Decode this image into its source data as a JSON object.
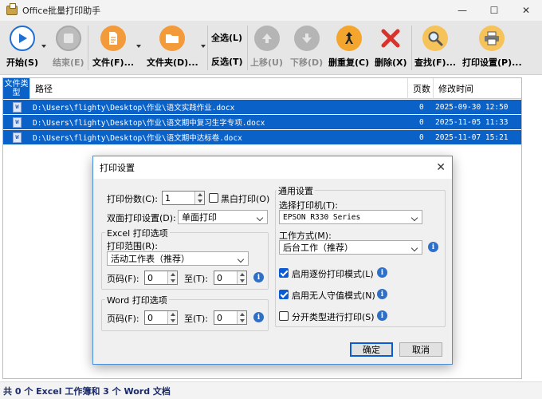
{
  "window": {
    "title": "Office批量打印助手",
    "minimize": "—",
    "maximize": "☐",
    "close": "✕"
  },
  "toolbar": {
    "start": "开始(S)",
    "stop": "结束(E)",
    "file": "文件(F)...",
    "folder": "文件夹(D)...",
    "select_all": "全选(L)",
    "invert": "反选(T)",
    "move_up": "上移(U)",
    "move_down": "下移(D)",
    "remove_dup": "删重复(C)",
    "delete": "删除(X)",
    "find": "查找(F)...",
    "print_settings": "打印设置(P)..."
  },
  "table": {
    "headers": {
      "type": "文件类型",
      "path": "路径",
      "pages": "页数",
      "modified": "修改时间"
    },
    "rows": [
      {
        "icon": "W",
        "path": "D:\\Users\\flighty\\Desktop\\作业\\语文实践作业.docx",
        "pages": "0",
        "modified": "2025-09-30 12:50"
      },
      {
        "icon": "W",
        "path": "D:\\Users\\flighty\\Desktop\\作业\\语文期中复习生字专项.docx",
        "pages": "0",
        "modified": "2025-11-05 11:33"
      },
      {
        "icon": "W",
        "path": "D:\\Users\\flighty\\Desktop\\作业\\语文期中达标卷.docx",
        "pages": "0",
        "modified": "2025-11-07 15:21"
      }
    ]
  },
  "status": "共 0 个 Excel 工作簿和 3 个 Word 文档",
  "dialog": {
    "title": "打印设置",
    "close": "✕",
    "copies_label": "打印份数(C):",
    "copies_value": "1",
    "bw_label": "黑白打印(O)",
    "duplex_label": "双面打印设置(D):",
    "duplex_value": "单面打印",
    "excel_group": "Excel 打印选项",
    "range_label": "打印范围(R):",
    "range_value": "活动工作表（推荐）",
    "page_from_label": "页码(F):",
    "page_from_value": "0",
    "page_to_label": "至(T):",
    "page_to_value": "0",
    "word_group": "Word 打印选项",
    "word_from_label": "页码(F):",
    "word_from_value": "0",
    "word_to_label": "至(T):",
    "word_to_value": "0",
    "general_group": "通用设置",
    "printer_label": "选择打印机(T):",
    "printer_value": "EPSON R330 Series",
    "mode_label": "工作方式(M):",
    "mode_value": "后台工作（推荐）",
    "collate_label": "启用逐份打印模式(L)",
    "unattended_label": "启用无人守值模式(N)",
    "separate_label": "分开类型进行打印(S)",
    "ok": "确定",
    "cancel": "取消",
    "info": "i"
  },
  "colors": {
    "selection": "#0a62c9",
    "start_icon": "#1f6fd1",
    "delete_icon": "#d9342b",
    "brand_blue": "#0b5bd3"
  }
}
